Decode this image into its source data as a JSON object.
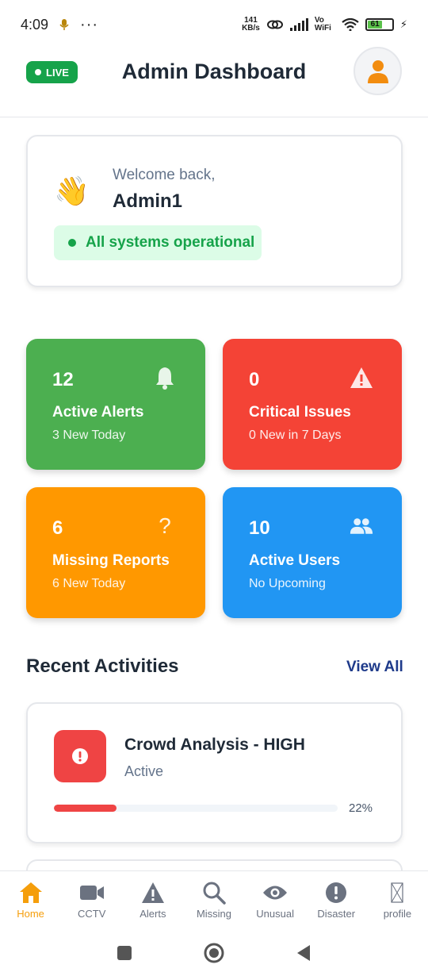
{
  "status_bar": {
    "time": "4:09",
    "speed_top": "141",
    "speed_bottom": "KB/s",
    "network": "Vo WiFi",
    "battery": "61"
  },
  "header": {
    "live_label": "LIVE",
    "title": "Admin Dashboard"
  },
  "welcome": {
    "greeting": "Welcome back,",
    "name": "Admin1",
    "status": "All systems operational"
  },
  "stats": [
    {
      "value": "12",
      "label": "Active Alerts",
      "sub": "3 New Today",
      "color": "#4caf50",
      "icon": "bell-icon"
    },
    {
      "value": "0",
      "label": "Critical Issues",
      "sub": "0 New in 7 Days",
      "color": "#f44336",
      "icon": "warning-icon"
    },
    {
      "value": "6",
      "label": "Missing Reports",
      "sub": "6 New Today",
      "color": "#ff9800",
      "icon": "question-icon"
    },
    {
      "value": "10",
      "label": "Active Users",
      "sub": "No Upcoming",
      "color": "#2196f3",
      "icon": "users-icon"
    }
  ],
  "recent": {
    "title": "Recent Activities",
    "view_all": "View All",
    "items": [
      {
        "title": "Crowd Analysis - HIGH",
        "status": "Active",
        "progress_label": "22%",
        "progress": 0.22
      }
    ]
  },
  "tabs": [
    {
      "label": "Home",
      "icon": "home-icon",
      "active": true
    },
    {
      "label": "CCTV",
      "icon": "video-icon"
    },
    {
      "label": "Alerts",
      "icon": "warning-icon"
    },
    {
      "label": "Missing",
      "icon": "search-icon"
    },
    {
      "label": "Unusual",
      "icon": "eye-icon"
    },
    {
      "label": "Disaster",
      "icon": "alert-circle-icon"
    },
    {
      "label": "profile",
      "icon": "broken-image-icon"
    }
  ]
}
